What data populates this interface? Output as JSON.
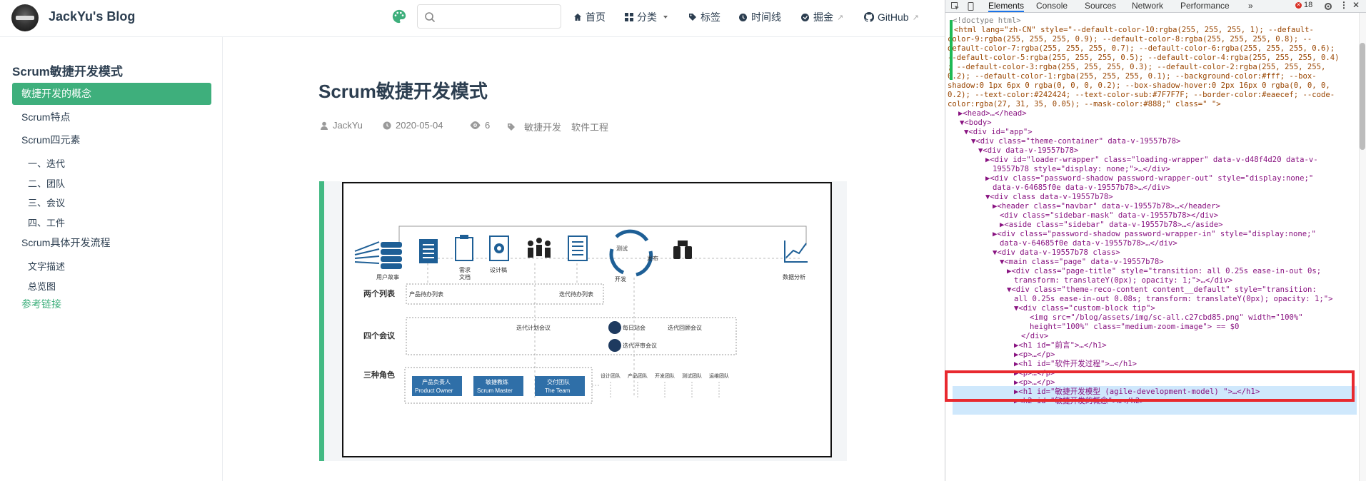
{
  "navbar": {
    "site_name": "JackYu's Blog",
    "search_placeholder": "",
    "links": [
      {
        "label": "首页",
        "icon": "home-icon"
      },
      {
        "label": "分类",
        "icon": "grid-icon"
      },
      {
        "label": "标签",
        "icon": "tag-icon"
      },
      {
        "label": "时间线",
        "icon": "clock-icon"
      },
      {
        "label": "掘金",
        "icon": "juejin-icon"
      },
      {
        "label": "GitHub",
        "icon": "github-icon"
      }
    ]
  },
  "sidebar": {
    "title": "Scrum敏捷开发模式",
    "items": [
      {
        "label": "敏捷开发的概念",
        "active": true
      },
      {
        "label": "Scrum特点"
      },
      {
        "label": "Scrum四元素"
      },
      {
        "label": "一、迭代"
      },
      {
        "label": "二、团队"
      },
      {
        "label": "三、会议"
      },
      {
        "label": "四、工件"
      },
      {
        "label": "Scrum具体开发流程"
      },
      {
        "label": "文字描述"
      },
      {
        "label": "总览图"
      },
      {
        "label": "参考链接"
      }
    ]
  },
  "article": {
    "title": "Scrum敏捷开发模式",
    "author": "JackYu",
    "date": "2020-05-04",
    "views": "6",
    "tags": [
      "敏捷开发",
      "软件工程"
    ]
  },
  "figure": {
    "top_labels": [
      "用户故事",
      "需求\n文档",
      "设计稿",
      "测试",
      "发布",
      "开发",
      "数据分析"
    ],
    "row_labels": [
      "两个列表",
      "四个会议",
      "三种角色"
    ],
    "lists": [
      "产品待办列表",
      "迭代待办列表"
    ],
    "meetings": [
      "迭代计划会议",
      "每日站会",
      "迭代回顾会议",
      "迭代评审会议"
    ],
    "roles": [
      {
        "cn": "产品负责人",
        "en": "Product Owner"
      },
      {
        "cn": "敏捷教练",
        "en": "Scrum Master"
      },
      {
        "cn": "交付团队",
        "en": "The Team"
      }
    ],
    "teams": [
      "设计团队",
      "产品团队",
      "开发团队",
      "测试团队",
      "运维团队"
    ]
  },
  "devtools": {
    "tabs": [
      "Elements",
      "Console",
      "Sources",
      "Network",
      "Performance",
      "»"
    ],
    "error_count": "18",
    "lines": [
      {
        "t": "<!doctype html>"
      },
      {
        "t": "<html lang=\"zh-CN\" style=\"--default-color-10:rgba(255, 255, 255, 1); --default-"
      },
      {
        "t": "color-9:rgba(255, 255, 255, 0.9); --default-color-8:rgba(255, 255, 255, 0.8); --"
      },
      {
        "t": "default-color-7:rgba(255, 255, 255, 0.7); --default-color-6:rgba(255, 255, 255, 0.6);"
      },
      {
        "t": "--default-color-5:rgba(255, 255, 255, 0.5); --default-color-4:rgba(255, 255, 255, 0.4)"
      },
      {
        "t": "; --default-color-3:rgba(255, 255, 255, 0.3); --default-color-2:rgba(255, 255, 255,"
      },
      {
        "t": "0.2); --default-color-1:rgba(255, 255, 255, 0.1); --background-color:#fff; --box-"
      },
      {
        "t": "shadow:0 1px 6px 0 rgba(0, 0, 0, 0.2); --box-shadow-hover:0 2px 16px 0 rgba(0, 0, 0,"
      },
      {
        "t": "0.2); --text-color:#242424; --text-color-sub:#7F7F7F; --border-color:#eaecef; --code-"
      },
      {
        "t": "color:rgba(27, 31, 35, 0.05); --mask-color:#888;\" class=\" \">"
      },
      {
        "t": "▶<head>…</head>"
      },
      {
        "t": "▼<body>"
      },
      {
        "t": "▼<div id=\"app\">"
      },
      {
        "t": "▼<div class=\"theme-container\" data-v-19557b78>"
      },
      {
        "t": "▼<div data-v-19557b78>"
      },
      {
        "t": "▶<div id=\"loader-wrapper\" class=\"loading-wrapper\" data-v-d48f4d20 data-v-"
      },
      {
        "t": "19557b78 style=\"display: none;\">…</div>"
      },
      {
        "t": "▶<div class=\"password-shadow password-wrapper-out\" style=\"display:none;\""
      },
      {
        "t": "data-v-64685f0e data-v-19557b78>…</div>"
      },
      {
        "t": "▼<div class data-v-19557b78>"
      },
      {
        "t": "▶<header class=\"navbar\" data-v-19557b78>…</header>"
      },
      {
        "t": "<div class=\"sidebar-mask\" data-v-19557b78></div>"
      },
      {
        "t": "▶<aside class=\"sidebar\" data-v-19557b78>…</aside>"
      },
      {
        "t": "▶<div class=\"password-shadow password-wrapper-in\" style=\"display:none;\""
      },
      {
        "t": "data-v-64685f0e data-v-19557b78>…</div>"
      },
      {
        "t": "▼<div data-v-19557b78 class>"
      },
      {
        "t": "▼<main class=\"page\" data-v-19557b78>"
      },
      {
        "t": "▶<div class=\"page-title\" style=\"transition: all 0.25s ease-in-out 0s;"
      },
      {
        "t": "transform: translateY(0px); opacity: 1;\">…</div>"
      },
      {
        "t": "▼<div class=\"theme-reco-content content__default\" style=\"transition:"
      },
      {
        "t": "all 0.25s ease-in-out 0.08s; transform: translateY(0px); opacity: 1;\">"
      },
      {
        "t": "▼<div class=\"custom-block tip\">"
      },
      {
        "t": "<img src=\"/blog/assets/img/sc-all.c27cbd85.png\" width=\"100%\""
      },
      {
        "t": "height=\"100%\" class=\"medium-zoom-image\"> == $0"
      },
      {
        "t": "</div>"
      },
      {
        "t": "▶<h1 id=\"前言\">…</h1>"
      },
      {
        "t": "▶<p>…</p>"
      },
      {
        "t": "▶<h1 id=\"软件开发过程\">…</h1>"
      },
      {
        "t": "▶<p>…</p>"
      },
      {
        "t": "▶<p>…</p>"
      },
      {
        "t": "▶<h1 id=\"敏捷开发模型 (agile-development-model) \">…</h1>"
      },
      {
        "t": "▶<h2 id=\"敏捷开发的概念\">…</h2>"
      }
    ]
  }
}
